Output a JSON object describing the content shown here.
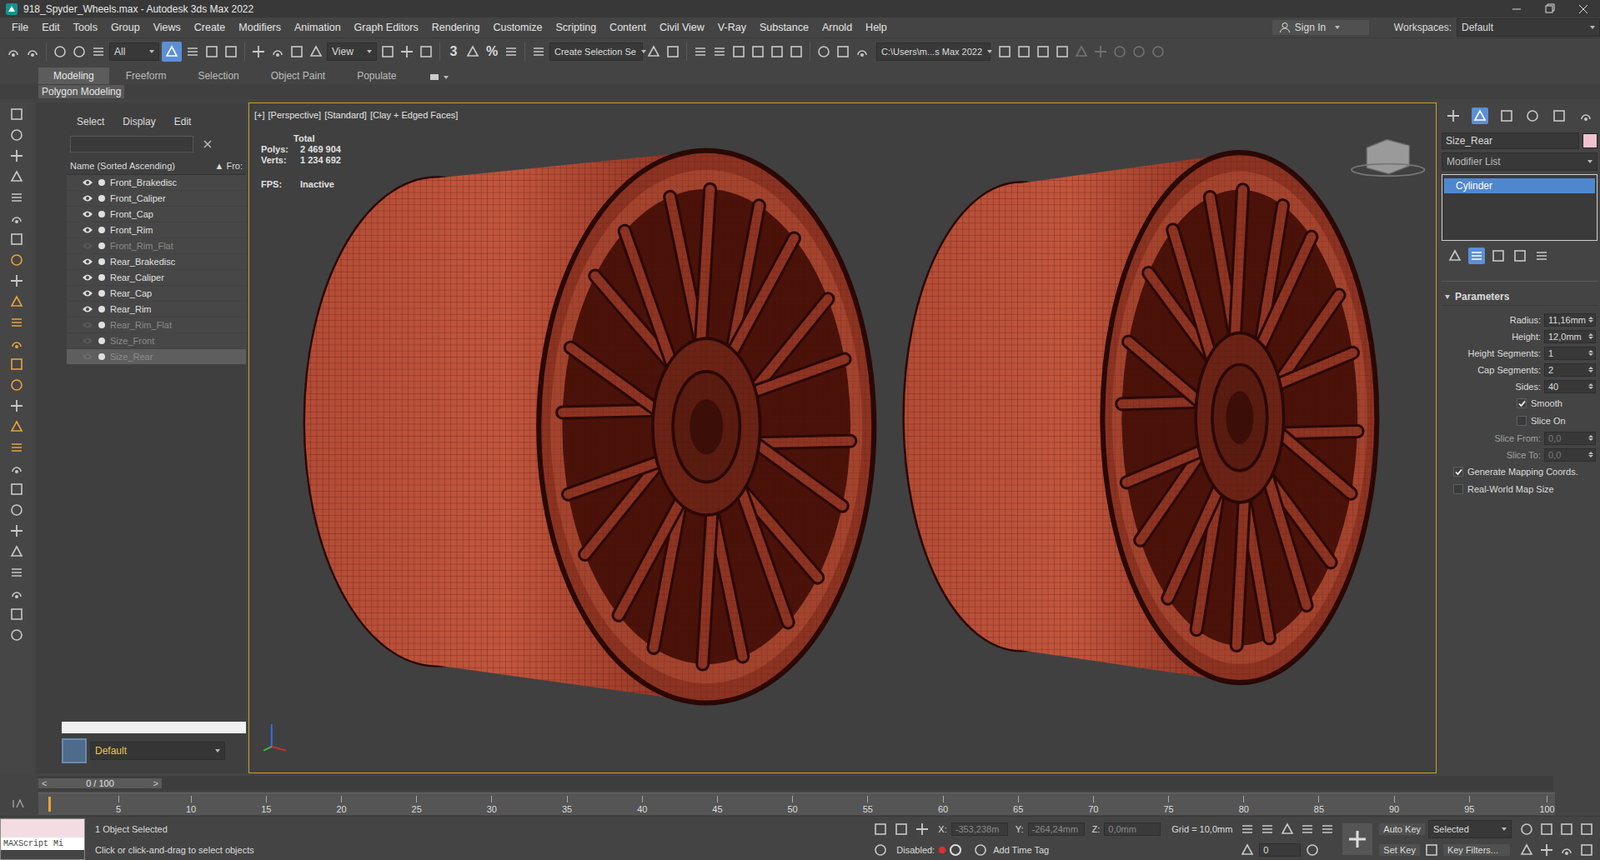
{
  "window": {
    "title": "918_Spyder_Wheels.max - Autodesk 3ds Max 2022"
  },
  "menu": [
    "File",
    "Edit",
    "Tools",
    "Group",
    "Views",
    "Create",
    "Modifiers",
    "Animation",
    "Graph Editors",
    "Rendering",
    "Customize",
    "Scripting",
    "Content",
    "Civil View",
    "V-Ray",
    "Substance",
    "Arnold",
    "Help"
  ],
  "account": {
    "sign_in": "Sign In",
    "workspaces_label": "Workspaces:",
    "workspace": "Default"
  },
  "toolbar": {
    "selection_filter": "All",
    "coord_system": "View",
    "snap": "3",
    "percent_snap": "%",
    "named_selection": "Create Selection Se",
    "project_path": "C:\\Users\\m...s Max 2022"
  },
  "ribbon": {
    "tabs": [
      {
        "label": "Modeling",
        "selected": true
      },
      {
        "label": "Freeform",
        "selected": false
      },
      {
        "label": "Selection",
        "selected": false
      },
      {
        "label": "Object Paint",
        "selected": false
      },
      {
        "label": "Populate",
        "selected": false
      }
    ],
    "panel": "Polygon Modeling"
  },
  "explorer": {
    "tabs": [
      "Select",
      "Display",
      "Edit"
    ],
    "column_name": "Name (Sorted Ascending)",
    "sort_glyph": "▲",
    "column_frozen": "Fro:",
    "items": [
      {
        "name": "Front_Brakedisc",
        "visible": true,
        "selected": false
      },
      {
        "name": "Front_Caliper",
        "visible": true,
        "selected": false
      },
      {
        "name": "Front_Cap",
        "visible": true,
        "selected": false
      },
      {
        "name": "Front_Rim",
        "visible": true,
        "selected": false
      },
      {
        "name": "Front_Rim_Flat",
        "visible": false,
        "selected": false
      },
      {
        "name": "Rear_Brakedisc",
        "visible": true,
        "selected": false
      },
      {
        "name": "Rear_Caliper",
        "visible": true,
        "selected": false
      },
      {
        "name": "Rear_Cap",
        "visible": true,
        "selected": false
      },
      {
        "name": "Rear_Rim",
        "visible": true,
        "selected": false
      },
      {
        "name": "Rear_Rim_Flat",
        "visible": false,
        "selected": false
      },
      {
        "name": "Size_Front",
        "visible": false,
        "selected": false
      },
      {
        "name": "Size_Rear",
        "visible": false,
        "selected": true
      }
    ],
    "layer": "Default"
  },
  "viewport": {
    "labels": [
      "[+]",
      "[Perspective]",
      "[Standard]",
      "[Clay + Edged Faces]"
    ],
    "active": true,
    "total": "Total",
    "stats": [
      {
        "label": "Polys:",
        "value": "2 469 904"
      },
      {
        "label": "Verts:",
        "value": "1 234 692"
      }
    ],
    "fps_label": "FPS:",
    "fps": "Inactive"
  },
  "command_panel": {
    "object_name": "Size_Rear",
    "modifier_list": "Modifier List",
    "stack": [
      {
        "label": "Cylinder",
        "selected": true
      }
    ],
    "rollout": "Parameters",
    "params": [
      {
        "kind": "spinner",
        "label": "Radius:",
        "value": "11,16mm",
        "disabled": false
      },
      {
        "kind": "spinner",
        "label": "Height:",
        "value": "12,0mm",
        "disabled": false
      },
      {
        "kind": "spinner",
        "label": "Height Segments:",
        "value": "1",
        "disabled": false
      },
      {
        "kind": "spinner",
        "label": "Cap Segments:",
        "value": "2",
        "disabled": false
      },
      {
        "kind": "spinner",
        "label": "Sides:",
        "value": "40",
        "disabled": false
      },
      {
        "kind": "toggle",
        "label": "Smooth",
        "checked": true,
        "disabled": false
      },
      {
        "kind": "toggle",
        "label": "Slice On",
        "checked": false,
        "disabled": false
      },
      {
        "kind": "spinner",
        "label": "Slice From:",
        "value": "0,0",
        "disabled": true
      },
      {
        "kind": "spinner",
        "label": "Slice To:",
        "value": "0,0",
        "disabled": true
      },
      {
        "kind": "check",
        "label": "Generate Mapping Coords.",
        "checked": true,
        "disabled": false
      },
      {
        "kind": "check",
        "label": "Real-World Map Size",
        "checked": false,
        "disabled": false
      }
    ]
  },
  "timeline": {
    "prev": "<",
    "frame": "0 / 100",
    "next": ">",
    "ticks": [
      "5",
      "10",
      "15",
      "20",
      "25",
      "30",
      "35",
      "40",
      "45",
      "50",
      "55",
      "60",
      "65",
      "70",
      "75",
      "80",
      "85",
      "90",
      "95",
      "100"
    ]
  },
  "status": {
    "selection": "1 Object Selected",
    "prompt": "Click or click-and-drag to select objects",
    "listener": "MAXScript Mi",
    "coords": [
      {
        "axis": "X:",
        "value": "-353,238m"
      },
      {
        "axis": "Y:",
        "value": "-264,24mm"
      },
      {
        "axis": "Z:",
        "value": "0,0mm"
      }
    ],
    "grid": "Grid = 10,0mm",
    "disabled_label": "Disabled:",
    "time_tag": "Add Time Tag",
    "frame": "0",
    "auto_key": "Auto Key",
    "key_mode": "Selected",
    "set_key": "Set Key",
    "key_filters": "Key Filters..."
  }
}
